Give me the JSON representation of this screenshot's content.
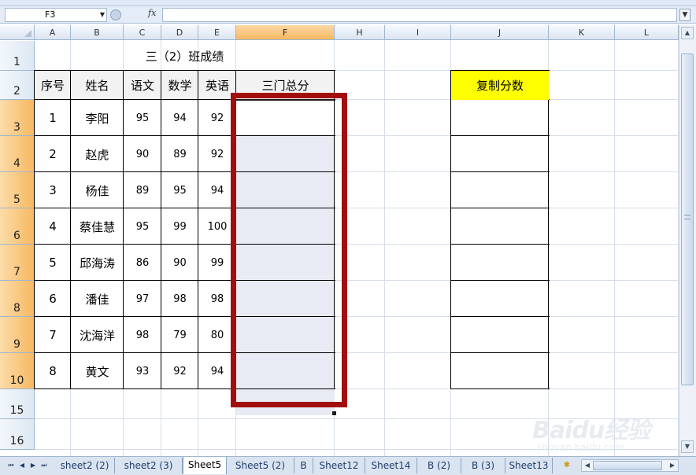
{
  "formula_bar": {
    "cell_ref": "F3",
    "fx_label": "fx",
    "value": ""
  },
  "columns": [
    "A",
    "B",
    "C",
    "D",
    "E",
    "F",
    "H",
    "I",
    "J",
    "K",
    "L"
  ],
  "selected_column": "F",
  "rows": [
    "1",
    "2",
    "3",
    "4",
    "5",
    "6",
    "7",
    "8",
    "9",
    "10",
    "15",
    "16"
  ],
  "selected_rows": [
    "3",
    "4",
    "5",
    "6",
    "7",
    "8",
    "9",
    "10"
  ],
  "sheet": {
    "title": "三（2）班成绩",
    "headers": [
      "序号",
      "姓名",
      "语文",
      "数学",
      "英语",
      "三门总分"
    ],
    "records": [
      [
        "1",
        "李阳",
        "95",
        "94",
        "92"
      ],
      [
        "2",
        "赵虎",
        "90",
        "89",
        "92"
      ],
      [
        "3",
        "杨佳",
        "89",
        "95",
        "94"
      ],
      [
        "4",
        "蔡佳慧",
        "95",
        "99",
        "100"
      ],
      [
        "5",
        "邱海涛",
        "86",
        "90",
        "99"
      ],
      [
        "6",
        "潘佳",
        "97",
        "98",
        "98"
      ],
      [
        "7",
        "沈海洋",
        "98",
        "79",
        "80"
      ],
      [
        "8",
        "黄文",
        "93",
        "92",
        "94"
      ]
    ],
    "copy_header": "复制分数",
    "copy_header_color": "#ffff00"
  },
  "sheet_tabs": [
    "sheet2 (2)",
    "sheet2 (3)",
    "Sheet5",
    "Sheet5 (2)",
    "B",
    "Sheet12",
    "Sheet14",
    "B (2)",
    "B (3)",
    "Sheet13"
  ],
  "active_tab": "Sheet5",
  "annotation_color": "#a30d0d",
  "selection_color": "#e8ebf3",
  "watermark": {
    "logo": "Baidu经验",
    "sub": "jingyan.baidu.com"
  }
}
